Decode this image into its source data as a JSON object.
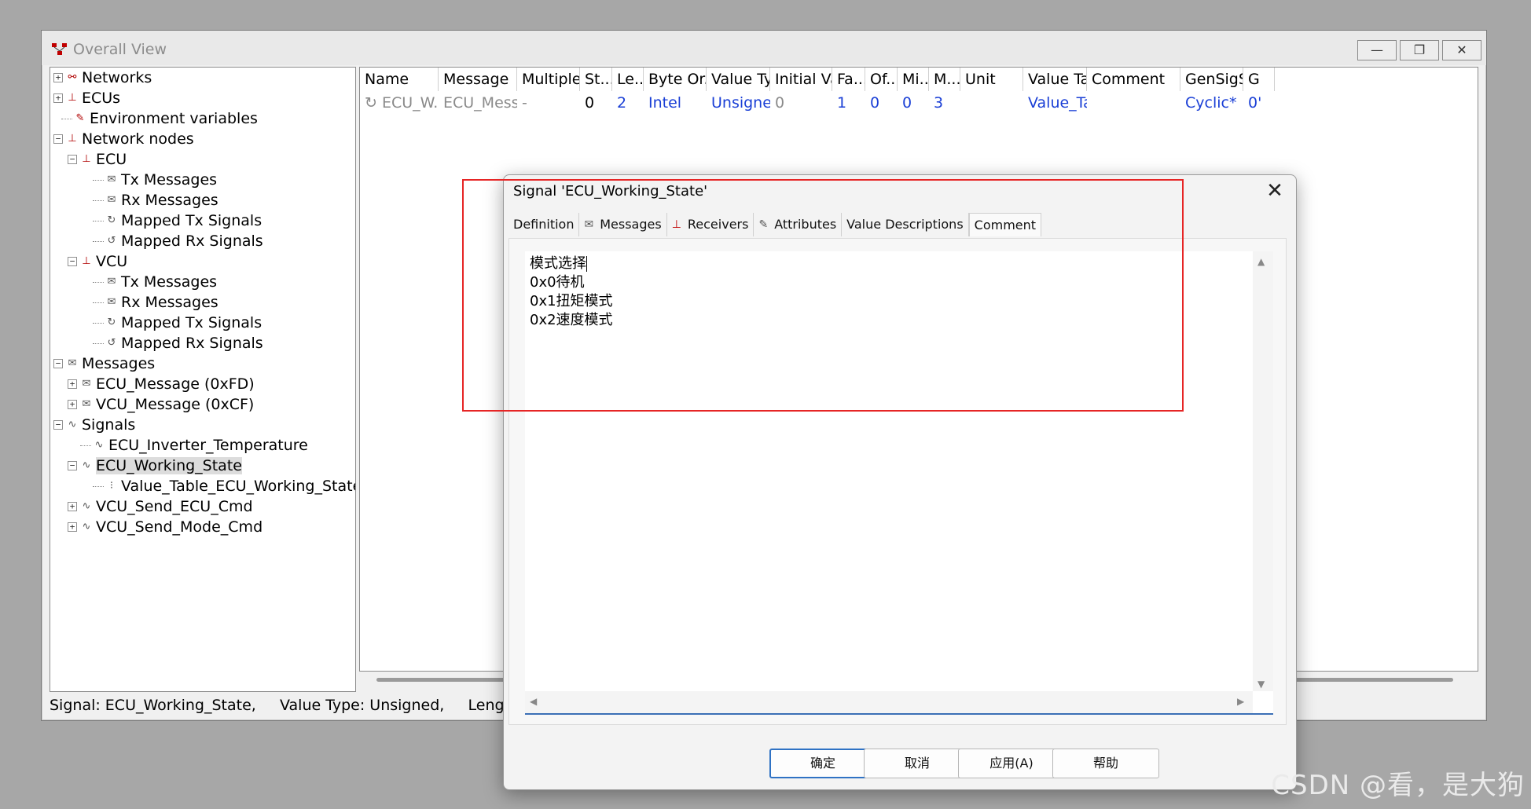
{
  "window": {
    "title": "Overall View",
    "minimize": "—",
    "restore": "❐",
    "close": "✕"
  },
  "tree": [
    {
      "label": "Networks",
      "exp": "+",
      "icon": "network-icon",
      "glyph": "⚯"
    },
    {
      "label": "ECUs",
      "exp": "+",
      "icon": "ecu-icon",
      "glyph": "⊥"
    },
    {
      "label": "Environment variables",
      "exp": "",
      "icon": "env-var-icon",
      "glyph": "✎"
    },
    {
      "label": "Network nodes",
      "exp": "−",
      "icon": "node-icon",
      "glyph": "⊥"
    },
    {
      "label": "ECU",
      "exp": "−",
      "icon": "node-icon",
      "glyph": "⊥"
    },
    {
      "label": "Tx Messages",
      "exp": "",
      "icon": "envelope-icon",
      "glyph": "✉"
    },
    {
      "label": "Rx Messages",
      "exp": "",
      "icon": "envelope-icon",
      "glyph": "✉"
    },
    {
      "label": "Mapped Tx Signals",
      "exp": "",
      "icon": "tx-signal-icon",
      "glyph": "↻"
    },
    {
      "label": "Mapped Rx Signals",
      "exp": "",
      "icon": "rx-signal-icon",
      "glyph": "↺"
    },
    {
      "label": "VCU",
      "exp": "−",
      "icon": "node-icon",
      "glyph": "⊥"
    },
    {
      "label": "Tx Messages",
      "exp": "",
      "icon": "envelope-icon",
      "glyph": "✉"
    },
    {
      "label": "Rx Messages",
      "exp": "",
      "icon": "envelope-icon",
      "glyph": "✉"
    },
    {
      "label": "Mapped Tx Signals",
      "exp": "",
      "icon": "tx-signal-icon",
      "glyph": "↻"
    },
    {
      "label": "Mapped Rx Signals",
      "exp": "",
      "icon": "rx-signal-icon",
      "glyph": "↺"
    },
    {
      "label": "Messages",
      "exp": "−",
      "icon": "envelope-icon",
      "glyph": "✉"
    },
    {
      "label": "ECU_Message (0xFD)",
      "exp": "+",
      "icon": "envelope-icon",
      "glyph": "✉"
    },
    {
      "label": "VCU_Message (0xCF)",
      "exp": "+",
      "icon": "envelope-icon",
      "glyph": "✉"
    },
    {
      "label": "Signals",
      "exp": "−",
      "icon": "signal-wave-icon",
      "glyph": "∿"
    },
    {
      "label": "ECU_Inverter_Temperature",
      "exp": "",
      "icon": "signal-wave-icon",
      "glyph": "∿"
    },
    {
      "label": "ECU_Working_State",
      "exp": "−",
      "icon": "signal-wave-icon",
      "glyph": "∿",
      "selected": true
    },
    {
      "label": "Value_Table_ECU_Working_State",
      "exp": "",
      "icon": "value-table-icon",
      "glyph": "⁝"
    },
    {
      "label": "VCU_Send_ECU_Cmd",
      "exp": "+",
      "icon": "signal-wave-icon",
      "glyph": "∿"
    },
    {
      "label": "VCU_Send_Mode_Cmd",
      "exp": "+",
      "icon": "signal-wave-icon",
      "glyph": "∿"
    }
  ],
  "grid": {
    "columns": [
      "Name",
      "Message",
      "Multiple...",
      "St...",
      "Le...",
      "Byte Or...",
      "Value Ty...",
      "Initial Va...",
      "Fa...",
      "Of...",
      "Mi...",
      "M...",
      "Unit",
      "Value Ta...",
      "Comment",
      "GenSigS...",
      "G"
    ],
    "row": [
      "ECU_W...",
      "ECU_Messa...",
      "-",
      "0",
      "2",
      "Intel",
      "Unsigned",
      "0",
      "1",
      "0",
      "0",
      "3",
      "",
      "Value_Ta...",
      "",
      "Cyclic*",
      "0'"
    ],
    "row_color": [
      "grey",
      "grey",
      "grey",
      "black",
      "blue",
      "blue",
      "blue",
      "grey",
      "blue",
      "blue",
      "blue",
      "blue",
      "black",
      "blue",
      "black",
      "blue",
      "blue"
    ]
  },
  "status": {
    "text": "Signal: ECU_Working_State,     Value Type: Unsigned,     Length [Bit]"
  },
  "dialog": {
    "title": "Signal 'ECU_Working_State'",
    "close": "✕",
    "tabs": [
      {
        "label": "Definition",
        "icon": ""
      },
      {
        "label": "Messages",
        "icon": "envelope-icon",
        "glyph": "✉"
      },
      {
        "label": "Receivers",
        "icon": "receiver-icon",
        "glyph": "⊥"
      },
      {
        "label": "Attributes",
        "icon": "attributes-icon",
        "glyph": "✎"
      },
      {
        "label": "Value Descriptions",
        "icon": ""
      },
      {
        "label": "Comment",
        "icon": "",
        "active": true
      }
    ],
    "comment_lines": [
      "模式选择",
      "0x0待机",
      "0x1扭矩模式",
      "0x2速度模式"
    ],
    "buttons": {
      "ok": "确定",
      "cancel": "取消",
      "apply": "应用(A)",
      "help": "帮助"
    }
  },
  "watermark": "CSDN @看，是大狗"
}
